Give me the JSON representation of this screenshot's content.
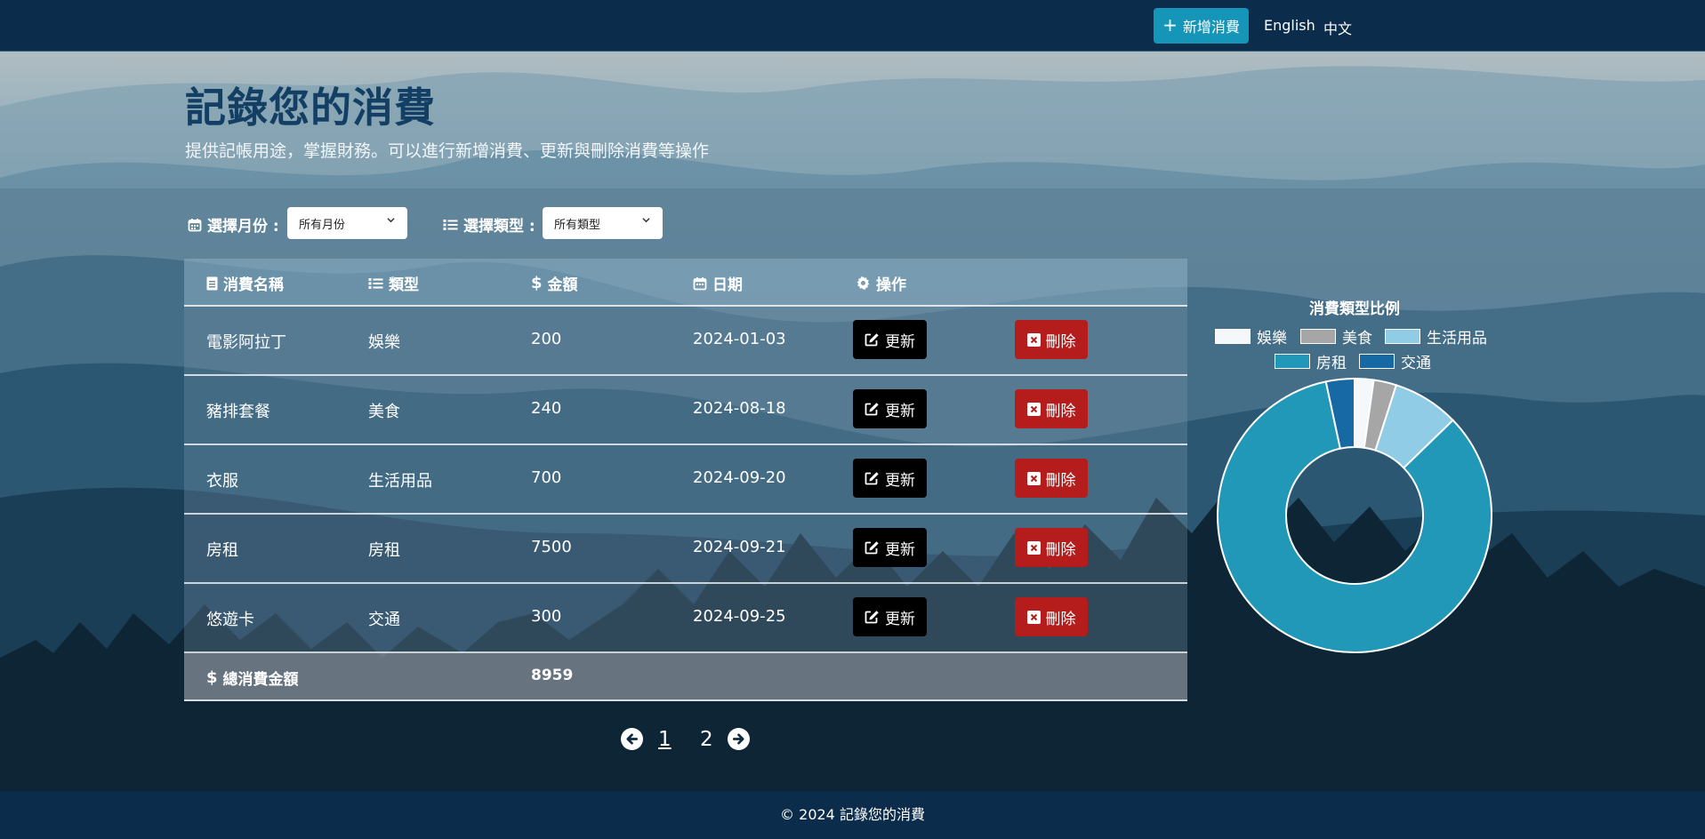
{
  "nav": {
    "add_button": "新增消費",
    "lang_en": "English",
    "lang_zh": "中文"
  },
  "hero": {
    "title": "記錄您的消費",
    "subtitle": "提供記帳用途，掌握財務。可以進行新增消費、更新與刪除消費等操作"
  },
  "filters": {
    "month_label": "選擇月份 :",
    "month_value": "所有月份",
    "type_label": "選擇類型 :",
    "type_value": "所有類型"
  },
  "table": {
    "headers": [
      "消費名稱",
      "類型",
      "金額",
      "日期",
      "操作"
    ],
    "rows": [
      {
        "name": "電影阿拉丁",
        "type": "娛樂",
        "amount": "200",
        "date": "2024-01-03"
      },
      {
        "name": "豬排套餐",
        "type": "美食",
        "amount": "240",
        "date": "2024-08-18"
      },
      {
        "name": "衣服",
        "type": "生活用品",
        "amount": "700",
        "date": "2024-09-20"
      },
      {
        "name": "房租",
        "type": "房租",
        "amount": "7500",
        "date": "2024-09-21"
      },
      {
        "name": "悠遊卡",
        "type": "交通",
        "amount": "300",
        "date": "2024-09-25"
      }
    ],
    "update_label": "更新",
    "delete_label": "刪除",
    "total_label": "總消費金額",
    "total_value": "8959"
  },
  "pagination": {
    "pages": [
      "1",
      "2"
    ],
    "current": "1"
  },
  "chart_data": {
    "type": "pie",
    "title": "消費類型比例",
    "categories": [
      "娛樂",
      "美食",
      "生活用品",
      "房租",
      "交通"
    ],
    "values": [
      200,
      240,
      700,
      7500,
      300
    ],
    "colors": [
      "#f4f8fb",
      "#a6a6a6",
      "#90cce6",
      "#2198b8",
      "#1769a3"
    ],
    "legend": "top",
    "donut": true
  },
  "footer": {
    "text": "© 2024 記錄您的消費"
  }
}
